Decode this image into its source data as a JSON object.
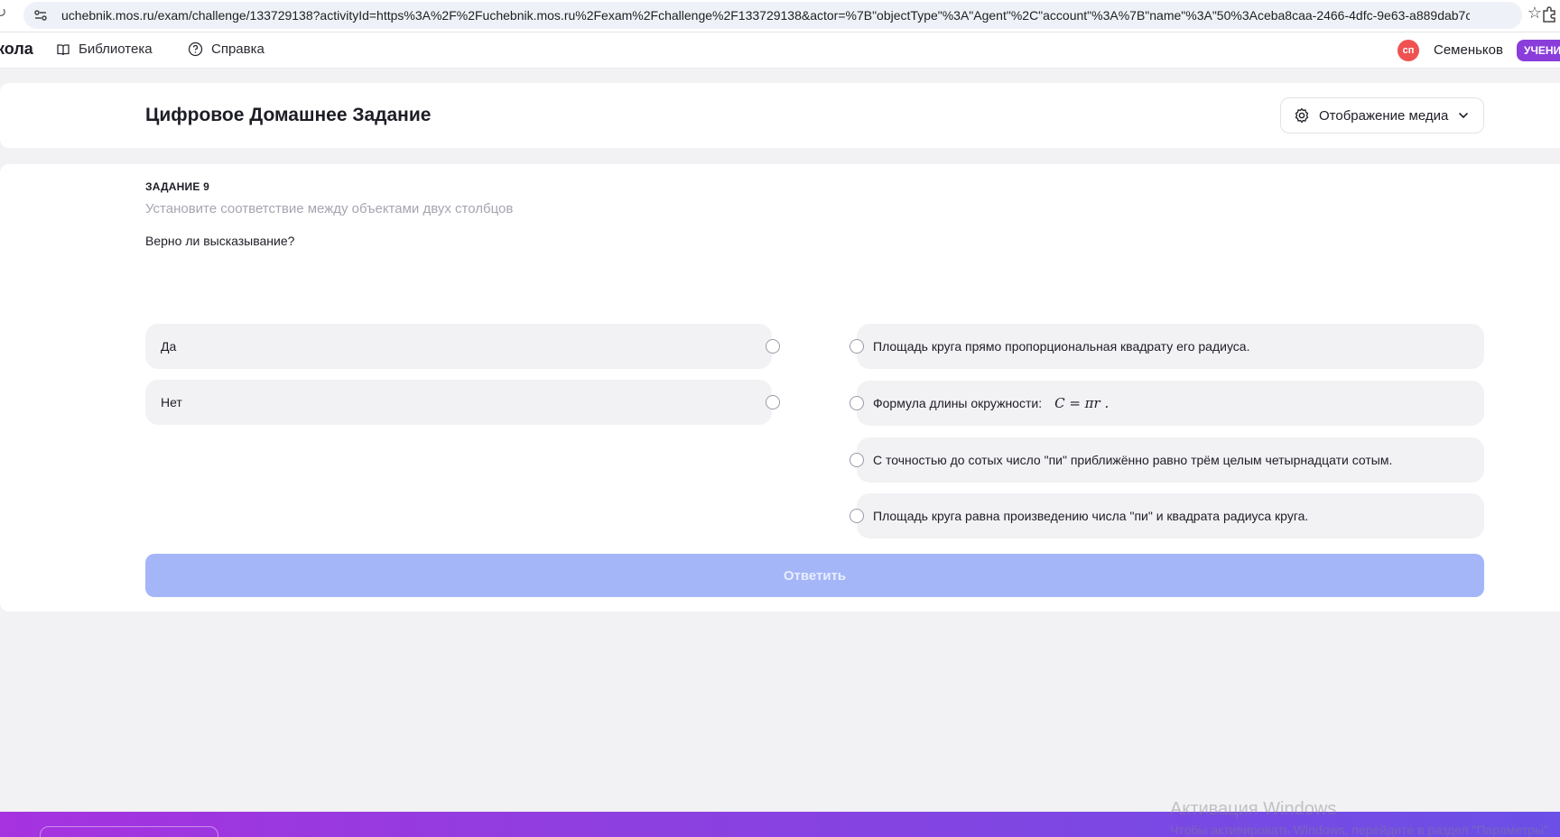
{
  "browser": {
    "url": "uchebnik.mos.ru/exam/challenge/133729138?activityId=https%3A%2F%2Fuchebnik.mos.ru%2Fexam%2Fchallenge%2F133729138&actor=%7B\"objectType\"%3A\"Agent\"%2C\"account\"%3A%7B\"name\"%3A\"50%3Aceba8caa-2466-4dfc-9e63-a889dab7ce44\"..."
  },
  "header": {
    "brand": "кола",
    "nav": [
      {
        "label": "Библиотека",
        "icon": "book-icon"
      },
      {
        "label": "Справка",
        "icon": "help-circle-icon"
      }
    ],
    "user": {
      "initials": "сп",
      "name": "Семеньков",
      "role": "УЧЕНИК",
      "avatar_color": "#f05252",
      "role_color": "#8b3ddc"
    }
  },
  "page": {
    "title": "Цифровое Домашнее Задание",
    "media_button": "Отображение медиа"
  },
  "task": {
    "number": "ЗАДАНИЕ 9",
    "instruction": "Установите соответствие между объектами двух столбцов",
    "question": "Верно ли высказывание?",
    "left_options": [
      "Да",
      "Нет"
    ],
    "right_options": [
      {
        "text": "Площадь круга прямо пропорциональная квадрату его радиуса."
      },
      {
        "text": "Формула длины окружности:",
        "formula": "C = πr ."
      },
      {
        "text": "С точностью до сотых число \"пи\" приближённо равно трём целым четырнадцати сотым."
      },
      {
        "text": "Площадь круга равна произведению числа \"пи\" и квадрата радиуса круга."
      }
    ],
    "submit_label": "Ответить",
    "submit_color": "#a4b6f8"
  },
  "os_watermark": {
    "line1": "Активация Windows",
    "line2": "Чтобы активировать Windows, перейдите в раздел \"Параметры\"."
  }
}
